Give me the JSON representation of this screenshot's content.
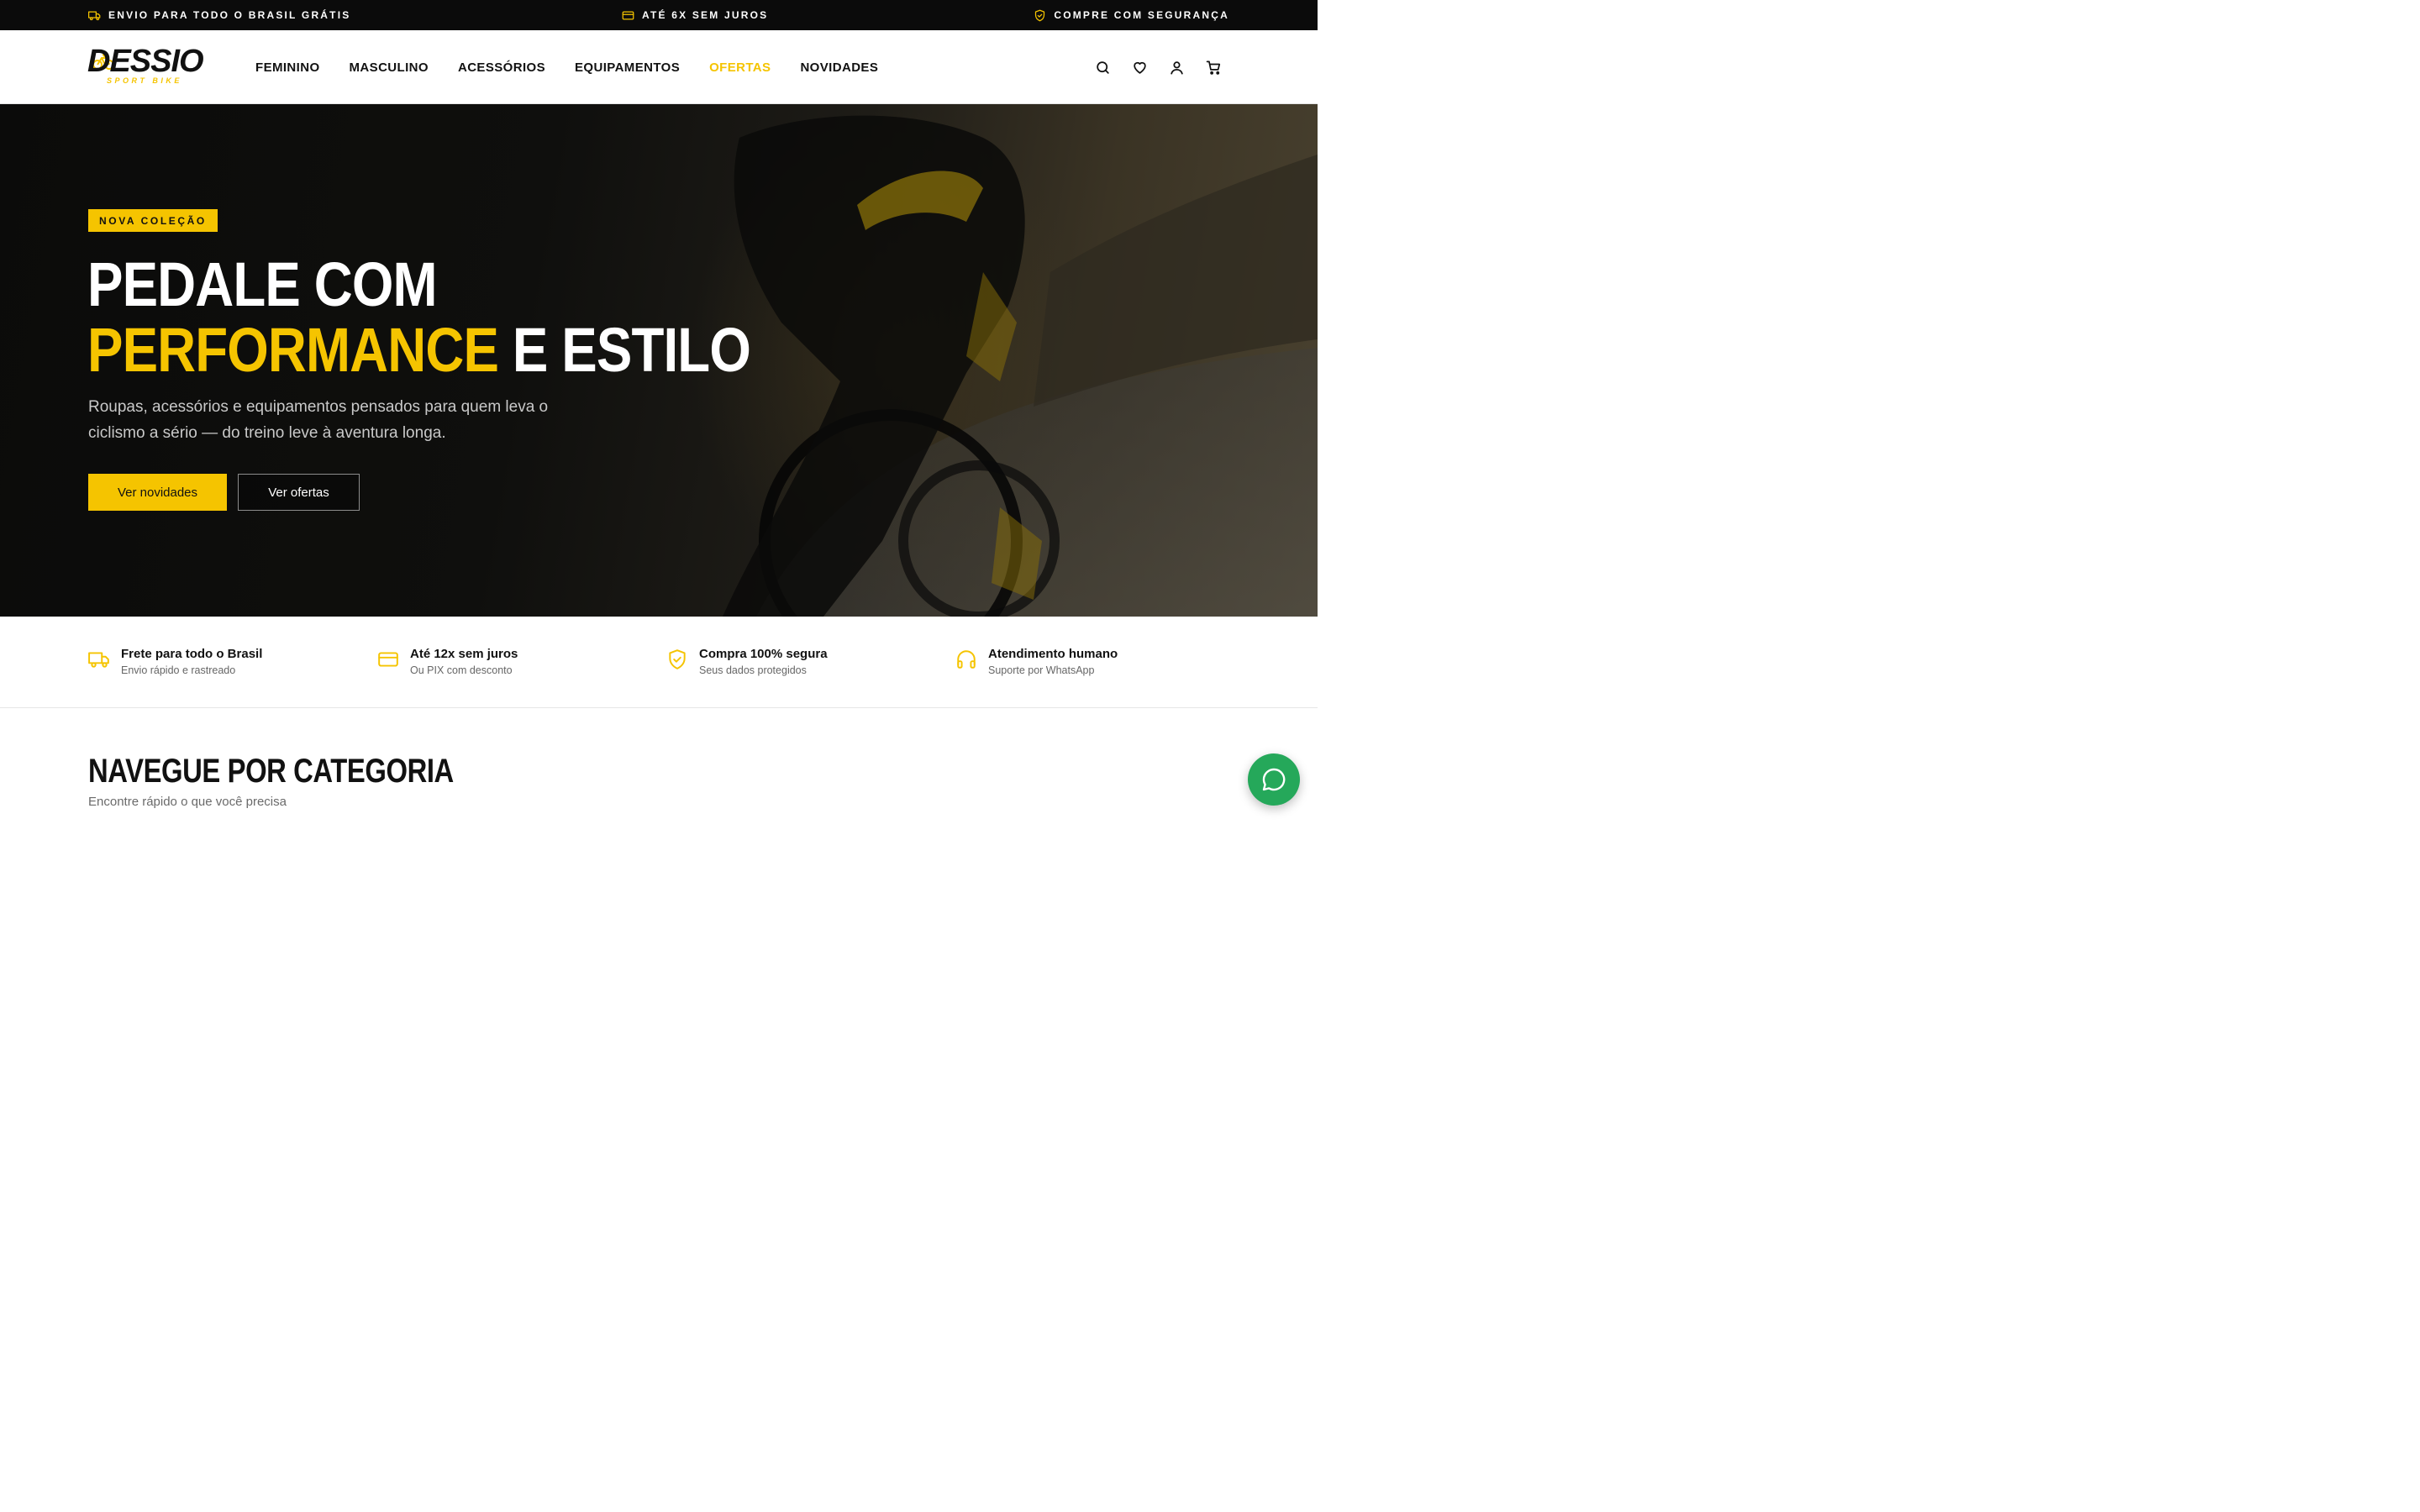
{
  "topbar": {
    "promo_shipping": "ENVIO PARA TODO O BRASIL GRÁTIS",
    "promo_installments": "ATÉ 6X SEM JUROS",
    "promo_security": "COMPRE COM SEGURANÇA"
  },
  "brand": {
    "name": "DESSIO",
    "tagline": "SPORT BIKE"
  },
  "nav": {
    "items": [
      {
        "label": "FEMININO"
      },
      {
        "label": "MASCULINO"
      },
      {
        "label": "ACESSÓRIOS"
      },
      {
        "label": "EQUIPAMENTOS"
      },
      {
        "label": "OFERTAS"
      },
      {
        "label": "NOVIDADES"
      }
    ]
  },
  "header_icons": [
    "search-icon",
    "heart-icon",
    "user-icon",
    "cart-icon"
  ],
  "hero": {
    "badge": "NOVA COLEÇÃO",
    "title_line1": "PEDALE COM",
    "title_highlight": "PERFORMANCE",
    "title_rest": " E ESTILO",
    "subtitle": "Roupas, acessórios e equipamentos pensados para quem leva o ciclismo a sério — do treino leve à aventura longa.",
    "btn_primary": "Ver novidades",
    "btn_secondary": "Ver ofertas"
  },
  "features": [
    {
      "icon": "truck-icon",
      "title": "Frete para todo o Brasil",
      "subtitle": "Envio rápido e rastreado"
    },
    {
      "icon": "credit-card-icon",
      "title": "Até 12x sem juros",
      "subtitle": "Ou PIX com desconto"
    },
    {
      "icon": "shield-check-icon",
      "title": "Compra 100% segura",
      "subtitle": "Seus dados protegidos"
    },
    {
      "icon": "headphones-icon",
      "title": "Atendimento humano",
      "subtitle": "Suporte por WhatsApp"
    }
  ],
  "category": {
    "title": "NAVEGUE POR CATEGORIA",
    "subtitle": "Encontre rápido o que você precisa"
  },
  "colors": {
    "accent": "#f5c400",
    "dark": "#0b0b0b",
    "whatsapp": "#25a85a"
  }
}
